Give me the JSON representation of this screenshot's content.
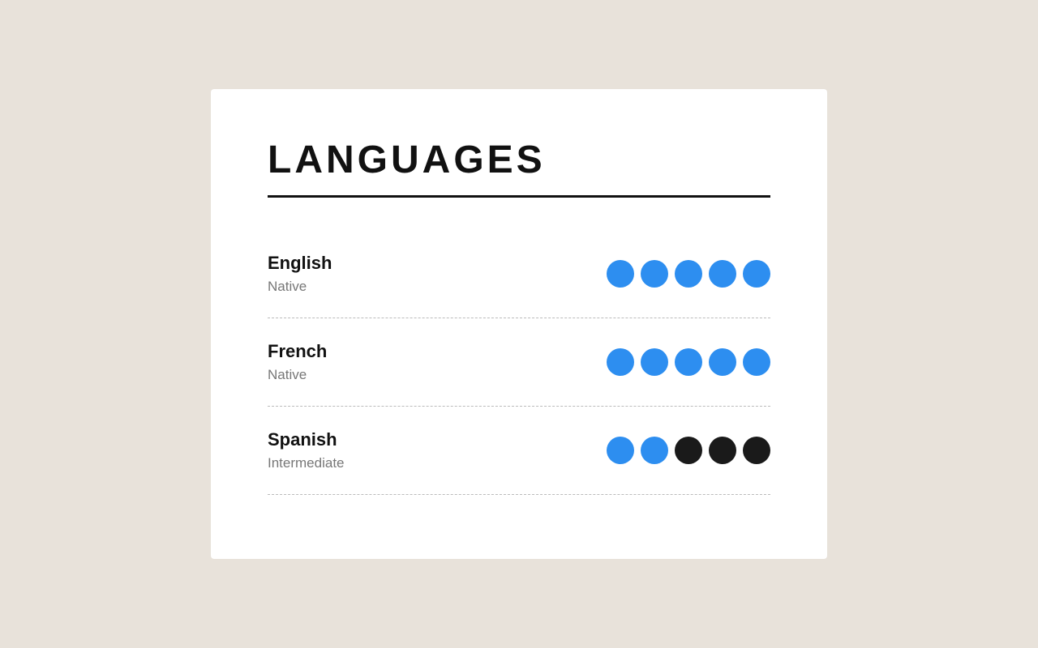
{
  "page": {
    "background_color": "#e8e2da",
    "card_background": "#ffffff"
  },
  "section": {
    "title": "LANGUAGES"
  },
  "languages": [
    {
      "name": "English",
      "level": "Native",
      "dots": [
        {
          "filled": true
        },
        {
          "filled": true
        },
        {
          "filled": true
        },
        {
          "filled": true
        },
        {
          "filled": true
        }
      ]
    },
    {
      "name": "French",
      "level": "Native",
      "dots": [
        {
          "filled": true
        },
        {
          "filled": true
        },
        {
          "filled": true
        },
        {
          "filled": true
        },
        {
          "filled": true
        }
      ]
    },
    {
      "name": "Spanish",
      "level": "Intermediate",
      "dots": [
        {
          "filled": true
        },
        {
          "filled": true
        },
        {
          "filled": false
        },
        {
          "filled": false
        },
        {
          "filled": false
        }
      ]
    }
  ],
  "colors": {
    "dot_blue": "#2d8ef0",
    "dot_dark": "#1a1a1a",
    "text_primary": "#111111",
    "text_secondary": "#777777",
    "divider": "#bbbbbb"
  }
}
